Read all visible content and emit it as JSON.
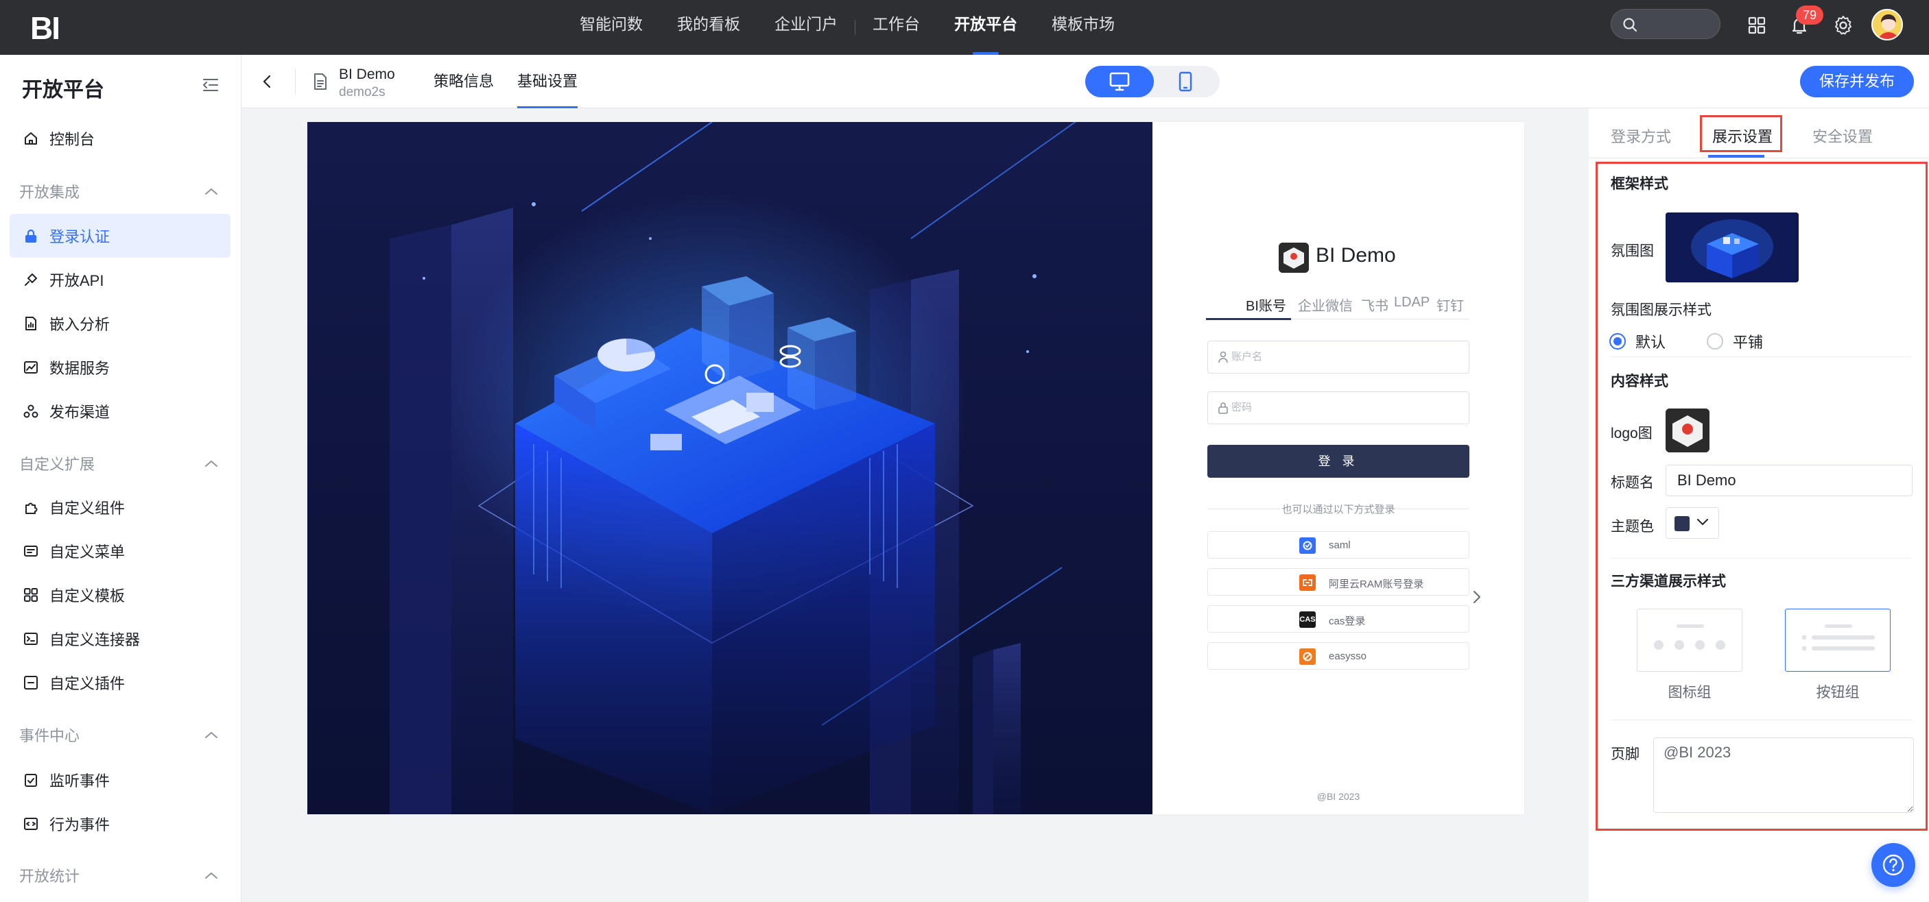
{
  "app": {
    "logo": "BI"
  },
  "topnav": {
    "items": [
      "智能问数",
      "我的看板",
      "企业门户",
      "工作台",
      "开放平台",
      "模板市场"
    ],
    "active": "开放平台",
    "notification_count": "79"
  },
  "sidebar": {
    "title": "开放平台",
    "items": {
      "console": "控制台",
      "group_integration": "开放集成",
      "login_auth": "登录认证",
      "open_api": "开放API",
      "embed_analysis": "嵌入分析",
      "data_service": "数据服务",
      "publish_channel": "发布渠道",
      "group_extension": "自定义扩展",
      "custom_component": "自定义组件",
      "custom_menu": "自定义菜单",
      "custom_template": "自定义模板",
      "custom_connector": "自定义连接器",
      "custom_plugin": "自定义插件",
      "group_event": "事件中心",
      "listen_event": "监听事件",
      "behavior_event": "行为事件",
      "group_stats": "开放统计"
    }
  },
  "subheader": {
    "project_name": "BI Demo",
    "project_sub": "demo2s",
    "tabs": [
      "策略信息",
      "基础设置"
    ],
    "active_tab": "基础设置",
    "publish_label": "保存并发布"
  },
  "preview": {
    "title": "BI Demo",
    "tabs": [
      "BI账号",
      "企业微信",
      "飞书",
      "LDAP",
      "钉钉"
    ],
    "active_tab": "BI账号",
    "username_placeholder": "账户名",
    "password_placeholder": "密码",
    "login_label": "登 录",
    "alt_login_text": "也可以通过以下方式登录",
    "sso": [
      {
        "label": "saml",
        "icon": "saml-icon",
        "color": "#3370ff",
        "glyph": ""
      },
      {
        "label": "阿里云RAM账号登录",
        "icon": "aliyun-icon",
        "color": "#f26b1d",
        "glyph": ""
      },
      {
        "label": "cas登录",
        "icon": "cas-icon",
        "color": "#1a1a1a",
        "glyph": "CAS"
      },
      {
        "label": "easysso",
        "icon": "easysso-icon",
        "color": "#f07c1f",
        "glyph": ""
      }
    ],
    "footer": "@BI 2023"
  },
  "settings": {
    "tabs": [
      "登录方式",
      "展示设置",
      "安全设置"
    ],
    "active_tab": "展示设置",
    "frame_style": "框架样式",
    "bg_image_label": "氛围图",
    "bg_display_label": "氛围图展示样式",
    "bg_display_options": [
      "默认",
      "平铺"
    ],
    "bg_display_selected": "默认",
    "content_style": "内容样式",
    "logo_label": "logo图",
    "title_label": "标题名",
    "title_value": "BI Demo",
    "theme_label": "主题色",
    "theme_color": "#2c3553",
    "channel_style": "三方渠道展示样式",
    "channel_options": [
      "图标组",
      "按钮组"
    ],
    "channel_selected": "按钮组",
    "footer_label": "页脚",
    "footer_value": "@BI 2023"
  },
  "colors": {
    "accent": "#3370ff",
    "highlight": "#e5473d",
    "topbar": "#2d2f33"
  }
}
